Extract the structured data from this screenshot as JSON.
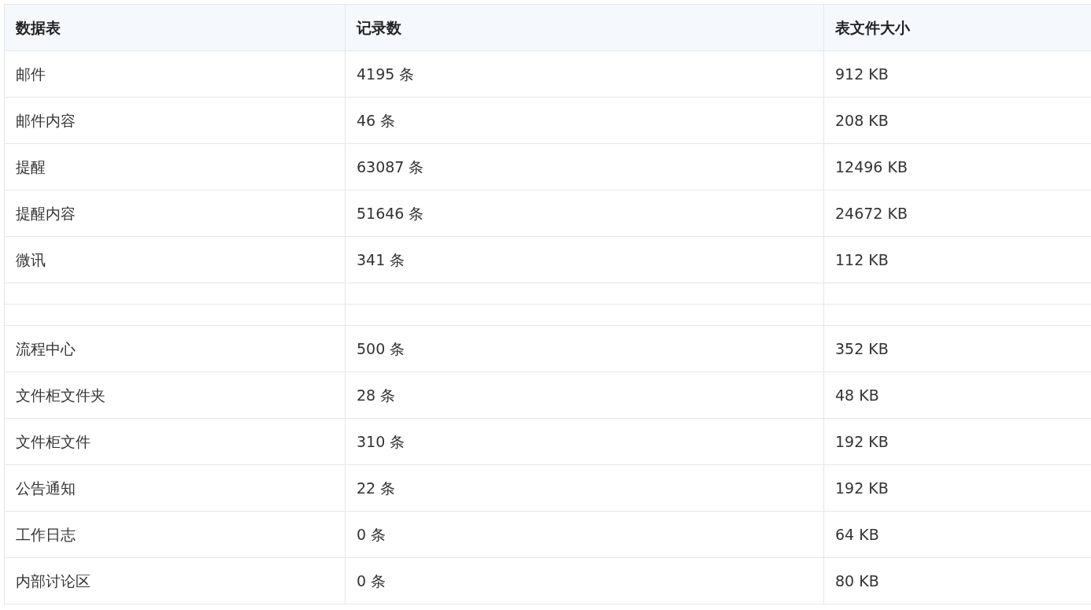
{
  "table": {
    "columns": [
      "数据表",
      "记录数",
      "表文件大小"
    ],
    "rows": [
      {
        "kind": "data",
        "cells": [
          "邮件",
          "4195 条",
          "912 KB"
        ]
      },
      {
        "kind": "data",
        "cells": [
          "邮件内容",
          "46 条",
          "208 KB"
        ]
      },
      {
        "kind": "data",
        "cells": [
          "提醒",
          "63087 条",
          "12496 KB"
        ]
      },
      {
        "kind": "data",
        "cells": [
          "提醒内容",
          "51646 条",
          "24672 KB"
        ]
      },
      {
        "kind": "data",
        "cells": [
          "微讯",
          "341 条",
          "112 KB"
        ]
      },
      {
        "kind": "blank"
      },
      {
        "kind": "blank"
      },
      {
        "kind": "data",
        "cells": [
          "流程中心",
          "500 条",
          "352 KB"
        ]
      },
      {
        "kind": "data",
        "cells": [
          "文件柜文件夹",
          "28 条",
          "48 KB"
        ]
      },
      {
        "kind": "data",
        "cells": [
          "文件柜文件",
          "310 条",
          "192 KB"
        ]
      },
      {
        "kind": "data",
        "cells": [
          "公告通知",
          "22 条",
          "192 KB"
        ]
      },
      {
        "kind": "data",
        "cells": [
          "工作日志",
          "0 条",
          "64 KB"
        ]
      },
      {
        "kind": "data",
        "cells": [
          "内部讨论区",
          "0 条",
          "80 KB"
        ]
      }
    ]
  }
}
